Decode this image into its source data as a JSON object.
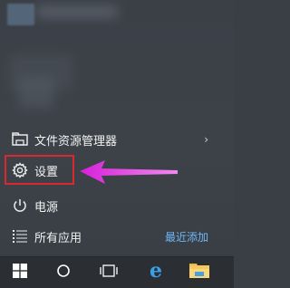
{
  "start_menu": {
    "items": [
      {
        "label": "文件资源管理器",
        "icon": "file-explorer-icon",
        "has_submenu": true
      },
      {
        "label": "设置",
        "icon": "gear-icon"
      },
      {
        "label": "电源",
        "icon": "power-icon"
      },
      {
        "label": "所有应用",
        "icon": "all-apps-icon",
        "link": "最近添加"
      }
    ],
    "chevron": "›"
  },
  "annotation": {
    "box_color": "#d9282f",
    "arrow_color": "#e23be6"
  },
  "taskbar": {
    "buttons": [
      {
        "name": "windows-start-icon"
      },
      {
        "name": "cortana-search-icon"
      },
      {
        "name": "task-view-icon"
      },
      {
        "name": "edge-browser-icon"
      },
      {
        "name": "file-explorer-taskbar-icon"
      }
    ],
    "accent": "#6fb6f5"
  }
}
